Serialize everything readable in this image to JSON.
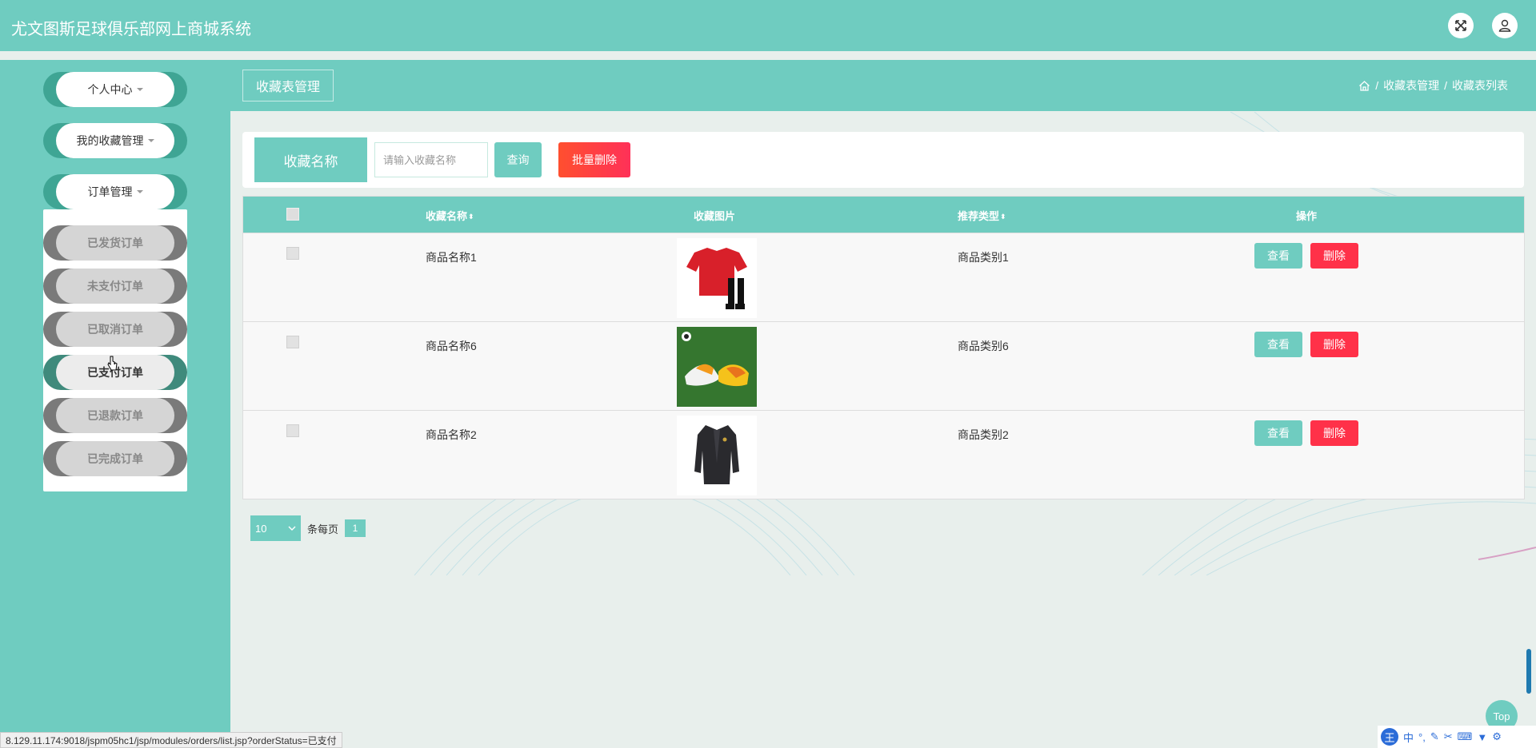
{
  "app": {
    "title": "尤文图斯足球俱乐部网上商城系统"
  },
  "topbar": {
    "expand_icon": "expand-icon",
    "user_icon": "user-icon"
  },
  "sidebar": {
    "menus": [
      {
        "label": "个人中心"
      },
      {
        "label": "我的收藏管理"
      },
      {
        "label": "订单管理"
      }
    ],
    "submenu": [
      {
        "label": "已发货订单"
      },
      {
        "label": "未支付订单"
      },
      {
        "label": "已取消订单"
      },
      {
        "label": "已支付订单"
      },
      {
        "label": "已退款订单"
      },
      {
        "label": "已完成订单"
      }
    ]
  },
  "breadcrumb": {
    "page_title": "收藏表管理",
    "home_icon": "home-icon",
    "items": [
      "收藏表管理",
      "收藏表列表"
    ],
    "separator": "/"
  },
  "search": {
    "label": "收藏名称",
    "placeholder": "请输入收藏名称",
    "value": "",
    "query_label": "查询",
    "batch_delete_label": "批量删除"
  },
  "table": {
    "headers": [
      "收藏名称",
      "收藏图片",
      "推荐类型",
      "操作"
    ],
    "sort_glyph": "⬍",
    "rows": [
      {
        "name": "商品名称1",
        "image": "red-jersey-image",
        "type": "商品类别1",
        "view": "查看",
        "delete": "删除"
      },
      {
        "name": "商品名称6",
        "image": "football-boots-image",
        "type": "商品类别6",
        "view": "查看",
        "delete": "删除"
      },
      {
        "name": "商品名称2",
        "image": "black-coat-image",
        "type": "商品类别2",
        "view": "查看",
        "delete": "删除"
      }
    ]
  },
  "pager": {
    "page_size": "10",
    "per_page_label": "条每页",
    "current_page": "1"
  },
  "status_url": "8.129.11.174:9018/jspm05hc1/jsp/modules/orders/list.jsp?orderStatus=已支付",
  "top_button": "Top",
  "ime": {
    "logo": "王",
    "lang": "中"
  },
  "colors": {
    "primary": "#6fccc0",
    "danger": "#ff3149",
    "sidebar_pill": "#3fa594"
  }
}
